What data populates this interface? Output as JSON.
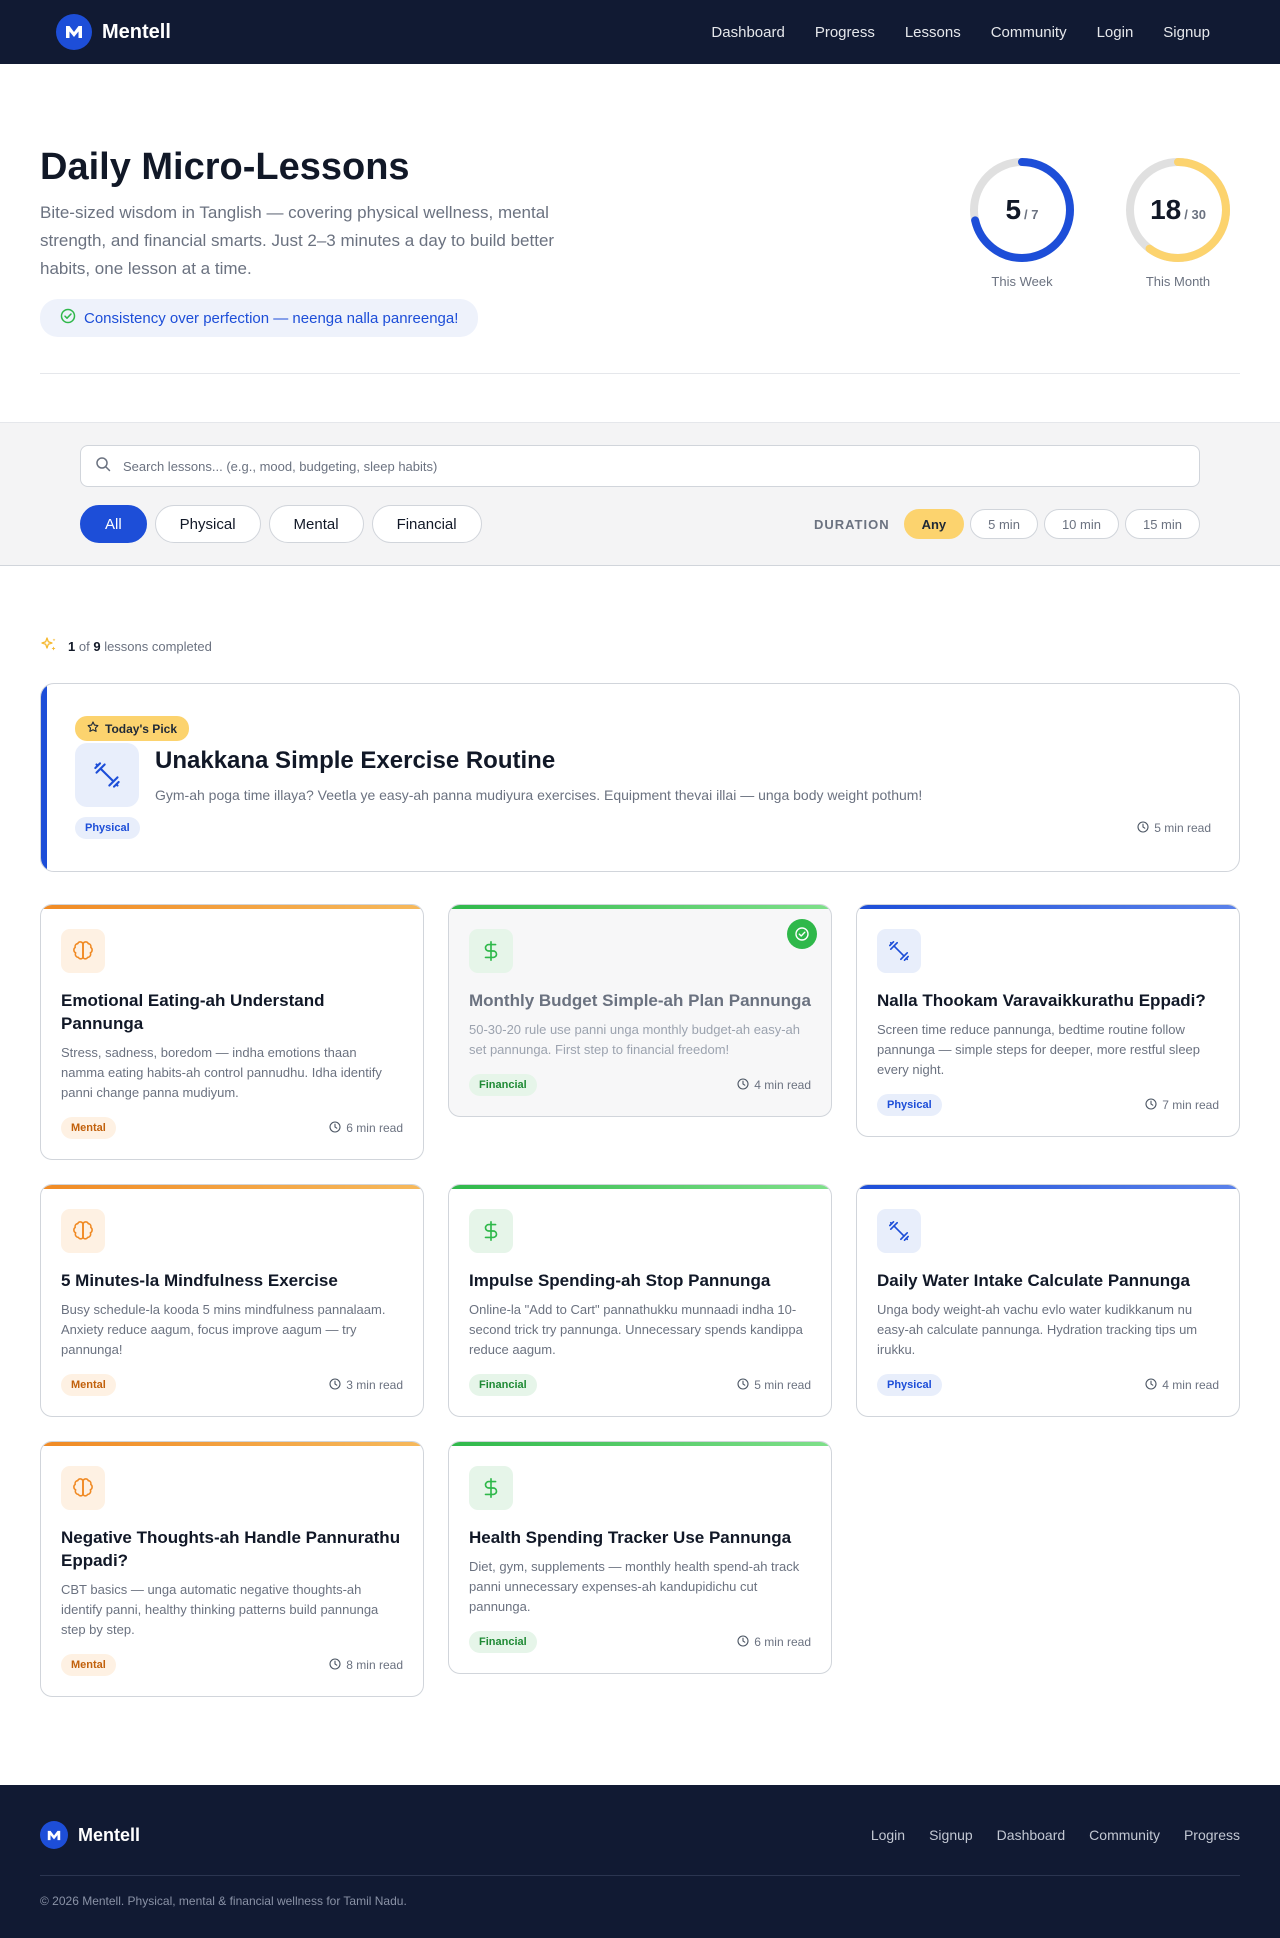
{
  "nav": {
    "brand": "Mentell",
    "links": [
      "Dashboard",
      "Progress",
      "Lessons",
      "Community",
      "Login",
      "Signup"
    ]
  },
  "hero": {
    "title": "Daily Micro-Lessons",
    "subtitle": "Bite-sized wisdom in Tanglish — covering physical wellness, mental strength, and financial smarts. Just 2–3 minutes a day to build better habits, one lesson at a time.",
    "pill": "Consistency over perfection — neenga nalla panreenga!"
  },
  "stats": {
    "week": {
      "value": "5",
      "total": "/ 7",
      "label": "This Week",
      "fraction": 0.714,
      "color": "#1d4ed8"
    },
    "month": {
      "value": "18",
      "total": "/ 30",
      "label": "This Month",
      "fraction": 0.6,
      "color": "#fcd36e"
    }
  },
  "search": {
    "placeholder": "Search lessons... (e.g., mood, budgeting, sleep habits)"
  },
  "categories": [
    "All",
    "Physical",
    "Mental",
    "Financial"
  ],
  "duration": {
    "label": "DURATION",
    "options": [
      "Any",
      "5 min",
      "10 min",
      "15 min"
    ]
  },
  "progress": {
    "done": "1",
    "of": "of",
    "total": "9",
    "suffix": "lessons completed"
  },
  "featured": {
    "badge": "Today's Pick",
    "title": "Unakkana Simple Exercise Routine",
    "desc": "Gym-ah poga time illaya? Veetla ye easy-ah panna mudiyura exercises. Equipment thevai illai — unga body weight pothum!",
    "tag": "Physical",
    "read": "5 min read"
  },
  "lessons": [
    {
      "title": "Emotional Eating-ah Understand Pannunga",
      "desc": "Stress, sadness, boredom — indha emotions thaan namma eating habits-ah control pannudhu. Idha identify panni change panna mudiyum.",
      "tag": "Mental",
      "read": "6 min read"
    },
    {
      "title": "Monthly Budget Simple-ah Plan Pannunga",
      "desc": "50-30-20 rule use panni unga monthly budget-ah easy-ah set pannunga. First step to financial freedom!",
      "tag": "Financial",
      "read": "4 min read"
    },
    {
      "title": "Nalla Thookam Varavaikkurathu Eppadi?",
      "desc": "Screen time reduce pannunga, bedtime routine follow pannunga — simple steps for deeper, more restful sleep every night.",
      "tag": "Physical",
      "read": "7 min read"
    },
    {
      "title": "5 Minutes-la Mindfulness Exercise",
      "desc": "Busy schedule-la kooda 5 mins mindfulness pannalaam. Anxiety reduce aagum, focus improve aagum — try pannunga!",
      "tag": "Mental",
      "read": "3 min read"
    },
    {
      "title": "Impulse Spending-ah Stop Pannunga",
      "desc": "Online-la \"Add to Cart\" pannathukku munnaadi indha 10-second trick try pannunga. Unnecessary spends kandippa reduce aagum.",
      "tag": "Financial",
      "read": "5 min read"
    },
    {
      "title": "Daily Water Intake Calculate Pannunga",
      "desc": "Unga body weight-ah vachu evlo water kudikkanum nu easy-ah calculate pannunga. Hydration tracking tips um irukku.",
      "tag": "Physical",
      "read": "4 min read"
    },
    {
      "title": "Negative Thoughts-ah Handle Pannurathu Eppadi?",
      "desc": "CBT basics — unga automatic negative thoughts-ah identify panni, healthy thinking patterns build pannunga step by step.",
      "tag": "Mental",
      "read": "8 min read"
    },
    {
      "title": "Health Spending Tracker Use Pannunga",
      "desc": "Diet, gym, supplements — monthly health spend-ah track panni unnecessary expenses-ah kandupidichu cut pannunga.",
      "tag": "Financial",
      "read": "6 min read"
    }
  ],
  "footer": {
    "brand": "Mentell",
    "links": [
      "Login",
      "Signup",
      "Dashboard",
      "Community",
      "Progress"
    ],
    "copyright": "© 2026 Mentell. Physical, mental & financial wellness for Tamil Nadu."
  },
  "colors": {
    "navy": "#111a33",
    "primary": "#1d4ed8",
    "accent_yellow": "#fcd36e",
    "mental": "#f08a24",
    "financial": "#2fb84a"
  }
}
